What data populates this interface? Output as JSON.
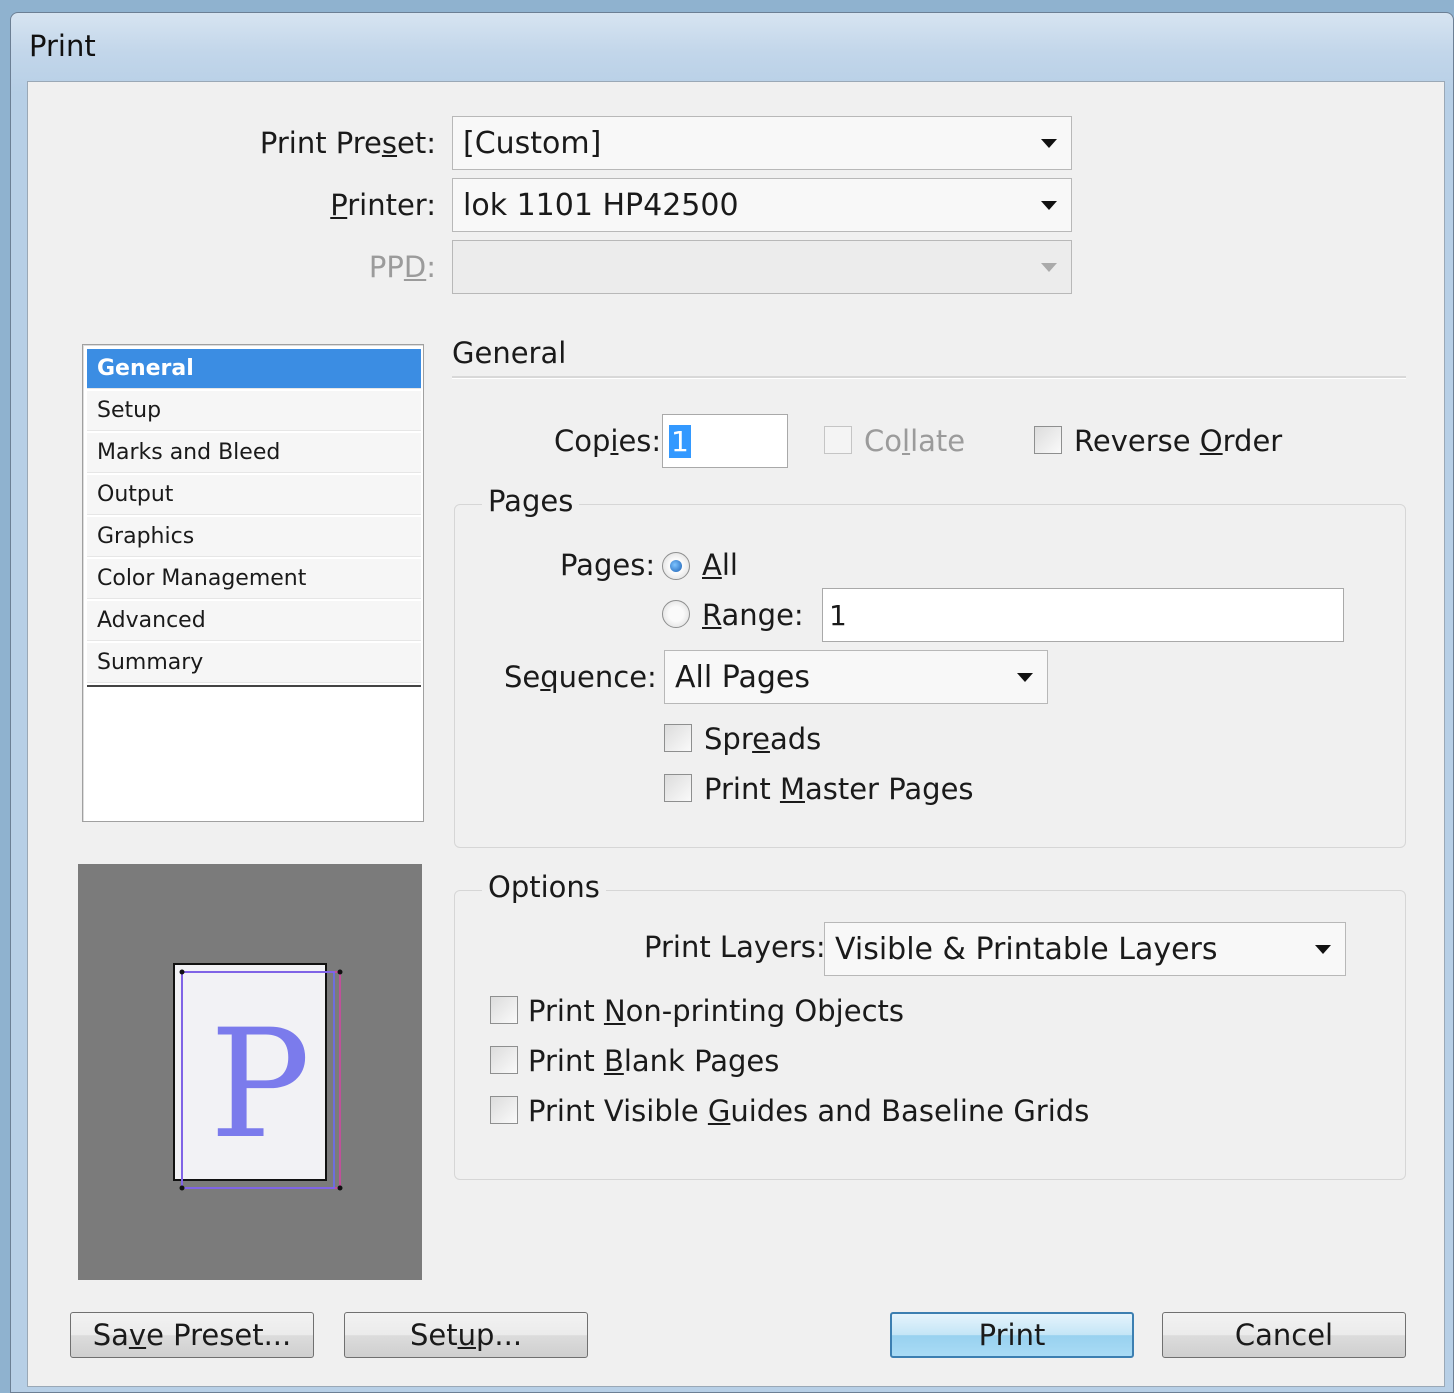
{
  "window": {
    "title": "Print"
  },
  "top": {
    "preset_label": "Print Preset:",
    "preset_value": "[Custom]",
    "printer_label": "Printer:",
    "printer_value": "lok 1101 HP42500",
    "ppd_label": "PPD:",
    "ppd_value": ""
  },
  "sidebar": {
    "items": [
      {
        "label": "General",
        "selected": true
      },
      {
        "label": "Setup"
      },
      {
        "label": "Marks and Bleed"
      },
      {
        "label": "Output"
      },
      {
        "label": "Graphics"
      },
      {
        "label": "Color Management"
      },
      {
        "label": "Advanced"
      },
      {
        "label": "Summary"
      }
    ]
  },
  "preview": {
    "letter": "P"
  },
  "general": {
    "section_title": "General",
    "copies_label": "Copies:",
    "copies_value": "1",
    "collate_label": "Collate",
    "reverse_label": "Reverse Order"
  },
  "pages": {
    "group_title": "Pages",
    "pages_label": "Pages:",
    "all_label": "All",
    "range_label": "Range:",
    "range_value": "1",
    "sequence_label": "Sequence:",
    "sequence_value": "All Pages",
    "spreads_label": "Spreads",
    "master_label": "Print Master Pages"
  },
  "options": {
    "group_title": "Options",
    "layers_label": "Print Layers:",
    "layers_value": "Visible & Printable Layers",
    "nonprinting_label": "Print Non-printing Objects",
    "blank_label": "Print Blank Pages",
    "guides_label": "Print Visible Guides and Baseline Grids"
  },
  "buttons": {
    "save_preset": "Save Preset...",
    "setup": "Setup...",
    "print": "Print",
    "cancel": "Cancel"
  },
  "colors": {
    "selection": "#3b8de3",
    "preview_bg": "#7b7b7b",
    "preview_letter": "#7b7bec"
  }
}
